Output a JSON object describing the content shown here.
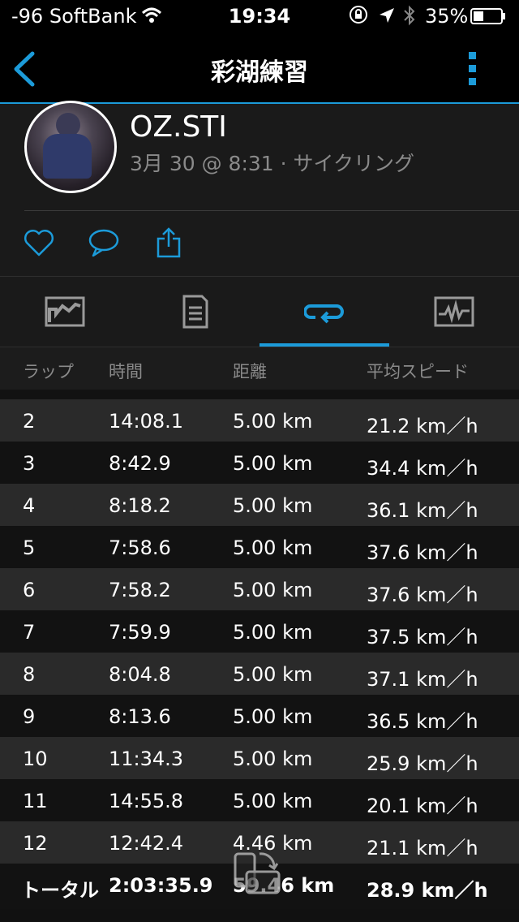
{
  "status_bar": {
    "carrier": "-96 SoftBank",
    "time": "19:34",
    "battery_percent": "35%",
    "icons": [
      "wifi-icon",
      "rotation-lock-icon",
      "location-icon",
      "bluetooth-icon",
      "battery-icon"
    ]
  },
  "nav": {
    "title": "彩湖練習",
    "back_icon": "chevron-left-icon",
    "more_icon": "vertical-ellipsis-icon"
  },
  "profile": {
    "username": "OZ.STI",
    "meta": "3月 30 @ 8:31 · サイクリング"
  },
  "actions": [
    "like-icon",
    "comment-icon",
    "share-icon"
  ],
  "tabs": [
    {
      "icon": "map-icon",
      "active": false
    },
    {
      "icon": "details-icon",
      "active": false
    },
    {
      "icon": "laps-icon",
      "active": true
    },
    {
      "icon": "chart-icon",
      "active": false
    }
  ],
  "table": {
    "headers": [
      "ラップ",
      "時間",
      "距離",
      "平均スピード"
    ],
    "rows": [
      [
        "2",
        "14:08.1",
        "5.00 km",
        "21.2 km／h"
      ],
      [
        "3",
        "8:42.9",
        "5.00 km",
        "34.4 km／h"
      ],
      [
        "4",
        "8:18.2",
        "5.00 km",
        "36.1 km／h"
      ],
      [
        "5",
        "7:58.6",
        "5.00 km",
        "37.6 km／h"
      ],
      [
        "6",
        "7:58.2",
        "5.00 km",
        "37.6 km／h"
      ],
      [
        "7",
        "7:59.9",
        "5.00 km",
        "37.5 km／h"
      ],
      [
        "8",
        "8:04.8",
        "5.00 km",
        "37.1 km／h"
      ],
      [
        "9",
        "8:13.6",
        "5.00 km",
        "36.5 km／h"
      ],
      [
        "10",
        "11:34.3",
        "5.00 km",
        "25.9 km／h"
      ],
      [
        "11",
        "14:55.8",
        "5.00 km",
        "20.1 km／h"
      ],
      [
        "12",
        "12:42.4",
        "4.46 km",
        "21.1 km／h"
      ]
    ],
    "total": [
      "トータル",
      "2:03:35.9",
      "59.46 km",
      "28.9 km／h"
    ]
  },
  "colors": {
    "accent": "#1c9bd9",
    "background": "#111111",
    "muted": "#8a8a8a"
  }
}
